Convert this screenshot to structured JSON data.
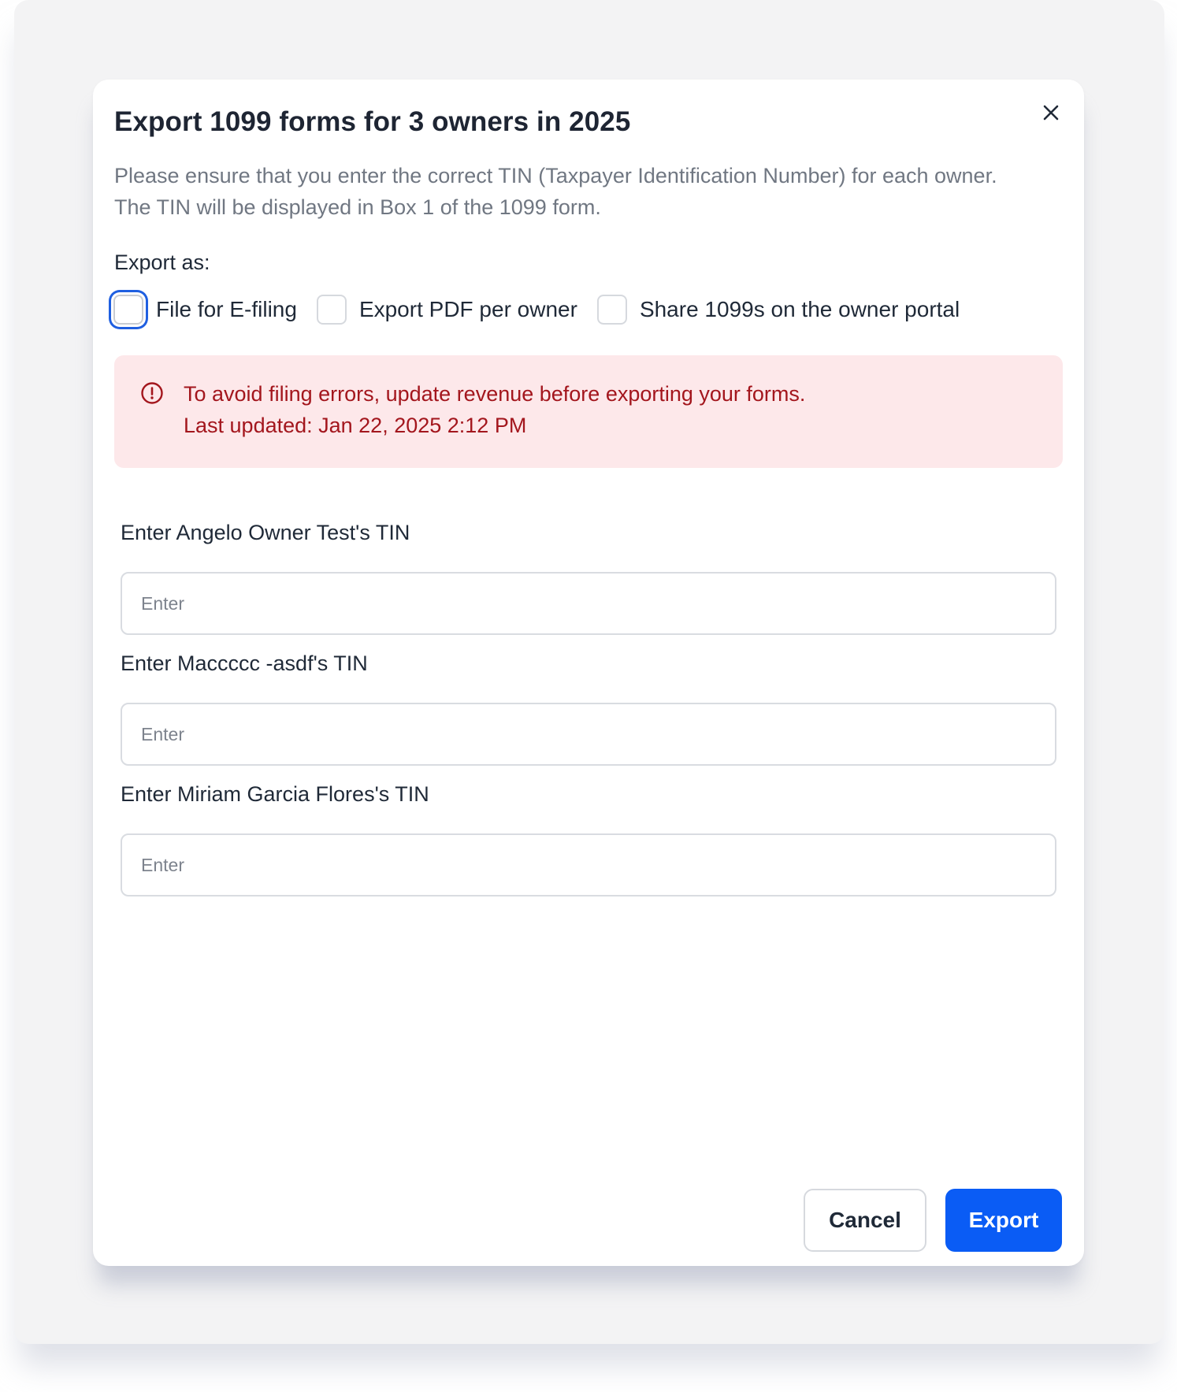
{
  "dialog": {
    "title": "Export 1099 forms for 3 owners in 2025",
    "close_icon": "close-icon",
    "description": "Please ensure that you enter the correct TIN (Taxpayer Identification Number) for each owner. The TIN will be displayed in Box 1 of the 1099 form."
  },
  "export_as": {
    "label": "Export as:",
    "options": [
      {
        "label": "File for E-filing",
        "checked": false,
        "focused": true
      },
      {
        "label": "Export PDF per owner",
        "checked": false,
        "focused": false
      },
      {
        "label": "Share 1099s on the owner portal",
        "checked": false,
        "focused": false
      }
    ]
  },
  "alert": {
    "icon": "alert-circle-icon",
    "message": "To avoid filing errors, update revenue before exporting your forms.",
    "last_updated": "Last updated: Jan 22, 2025 2:12 PM",
    "color": "#a3161d",
    "background": "#fde8ea"
  },
  "tin_fields": [
    {
      "label": "Enter Angelo Owner Test's TIN",
      "placeholder": "Enter",
      "value": ""
    },
    {
      "label": "Enter Maccccc -asdf's TIN",
      "placeholder": "Enter",
      "value": ""
    },
    {
      "label": "Enter Miriam Garcia Flores's TIN",
      "placeholder": "Enter",
      "value": ""
    }
  ],
  "footer": {
    "cancel_label": "Cancel",
    "export_label": "Export",
    "accent_color": "#0a5cf5"
  }
}
